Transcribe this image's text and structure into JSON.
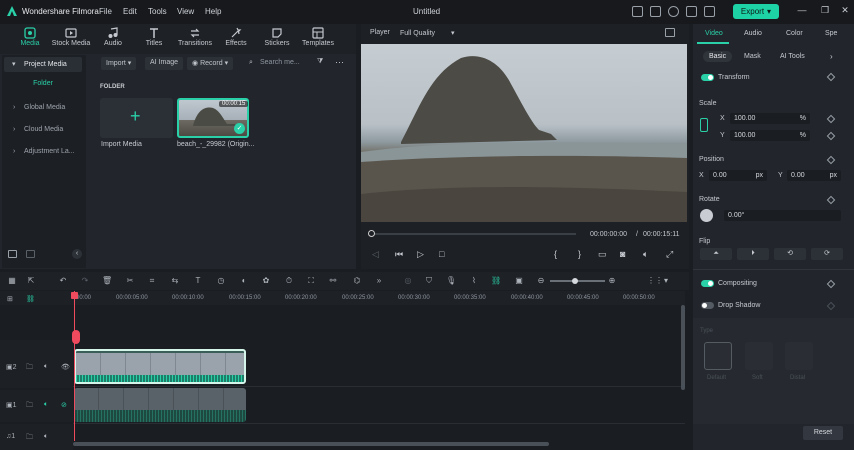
{
  "app": {
    "name": "Wondershare Filmora",
    "doc_title": "Untitled",
    "export_label": "Export"
  },
  "menu": [
    "File",
    "Edit",
    "Tools",
    "View",
    "Help"
  ],
  "tools": [
    {
      "label": "Media",
      "icon": "media-icon"
    },
    {
      "label": "Stock Media",
      "icon": "stock-media-icon"
    },
    {
      "label": "Audio",
      "icon": "music-note-icon"
    },
    {
      "label": "Titles",
      "icon": "titles-icon"
    },
    {
      "label": "Transitions",
      "icon": "transitions-icon"
    },
    {
      "label": "Effects",
      "icon": "effects-icon"
    },
    {
      "label": "Stickers",
      "icon": "stickers-icon"
    },
    {
      "label": "Templates",
      "icon": "templates-icon"
    }
  ],
  "sidebar": {
    "items": [
      "Project Media",
      "Global Media",
      "Cloud Media",
      "Adjustment La..."
    ],
    "folder": "Folder"
  },
  "media_toolbar": {
    "import": "Import",
    "ai_image": "AI Image",
    "record": "Record",
    "search_placeholder": "Search me..."
  },
  "media": {
    "folder_heading": "FOLDER",
    "import_label": "Import Media",
    "clip_label": "beach_-_29982 (Origin...",
    "clip_duration": "00:00:15"
  },
  "player": {
    "label": "Player",
    "quality": "Full Quality",
    "current_time": "00:00:00:00",
    "separator": "/",
    "total_time": "00:00:15:11"
  },
  "right_panel": {
    "tabs": [
      "Video",
      "Audio",
      "Color",
      "Spe"
    ],
    "subtabs": [
      "Basic",
      "Mask",
      "AI Tools"
    ],
    "transform": "Transform",
    "scale": {
      "label": "Scale",
      "x_label": "X",
      "x": "100.00",
      "y_label": "Y",
      "y": "100.00",
      "unit": "%"
    },
    "position": {
      "label": "Position",
      "x_label": "X",
      "x": "0.00",
      "y_label": "Y",
      "y": "0.00",
      "unit": "px"
    },
    "rotate": {
      "label": "Rotate",
      "value": "0.00°"
    },
    "flip": "Flip",
    "compositing": "Compositing",
    "drop_shadow": "Drop Shadow",
    "type": "Type",
    "shadow_types": [
      "Default",
      "Soft",
      "Distal"
    ],
    "reset": "Reset"
  },
  "timeline": {
    "ticks": [
      "00:00",
      "00:00:05:00",
      "00:00:10:00",
      "00:00:15:00",
      "00:00:20:00",
      "00:00:25:00",
      "00:00:30:00",
      "00:00:35:00",
      "00:00:40:00",
      "00:00:45:00",
      "00:00:50:00"
    ],
    "tracks": [
      {
        "num": "2"
      },
      {
        "num": "1"
      },
      {
        "num": "1"
      }
    ]
  },
  "colors": {
    "accent": "#2ad0a8",
    "playhead": "#f04a5e"
  }
}
